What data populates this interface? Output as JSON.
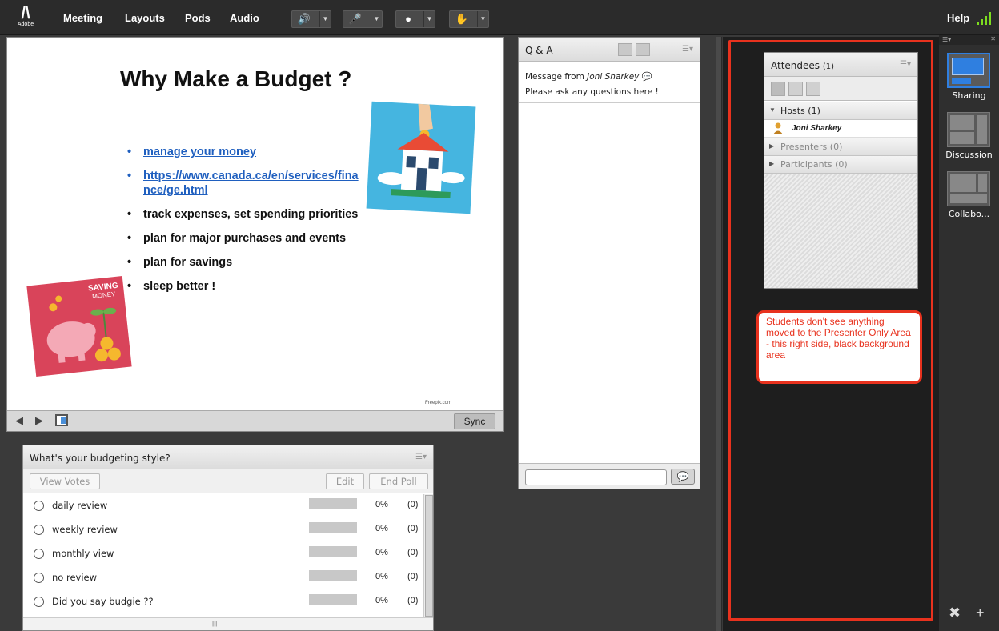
{
  "topbar": {
    "logo_text": "Adobe",
    "menus": [
      "Meeting",
      "Layouts",
      "Pods",
      "Audio"
    ],
    "help": "Help"
  },
  "share": {
    "title": "Why Make a Budget ?",
    "bullets": [
      {
        "text": "manage your money",
        "link": true
      },
      {
        "text": "https://www.canada.ca/en/services/finance/ge.html",
        "link": true
      },
      {
        "text": "track expenses, set spending priorities",
        "link": false
      },
      {
        "text": "plan for major purchases and events",
        "link": false
      },
      {
        "text": "plan for savings",
        "link": false
      },
      {
        "text": "sleep better !",
        "link": false
      }
    ],
    "bullet_line2": "ge.html",
    "piggy_text_1": "SAVING",
    "piggy_text_2": "MONEY",
    "credit": "Freepik.com",
    "sync_label": "Sync"
  },
  "qa": {
    "title": "Q & A",
    "message_prefix": "Message from",
    "message_author": "Joni Sharkey",
    "message_body": "Please ask any questions here !"
  },
  "poll": {
    "title": "What's your budgeting style?",
    "view_votes": "View Votes",
    "edit": "Edit",
    "end_poll": "End Poll",
    "options": [
      {
        "label": "daily review",
        "pct": "0%",
        "count": "(0)"
      },
      {
        "label": "weekly review",
        "pct": "0%",
        "count": "(0)"
      },
      {
        "label": "monthly view",
        "pct": "0%",
        "count": "(0)"
      },
      {
        "label": "no review",
        "pct": "0%",
        "count": "(0)"
      },
      {
        "label": "Did you say budgie ??",
        "pct": "0%",
        "count": "(0)"
      }
    ]
  },
  "attendees": {
    "title": "Attendees",
    "count": "(1)",
    "hosts": "Hosts (1)",
    "host_name": "Joni Sharkey",
    "presenters": "Presenters (0)",
    "participants": "Participants (0)"
  },
  "callout_text": "Students don't see anything moved to the Presenter Only Area - this right side, black background area",
  "layouts": [
    {
      "label": "Sharing",
      "active": true
    },
    {
      "label": "Discussion",
      "active": false
    },
    {
      "label": "Collabo...",
      "active": false
    }
  ],
  "colors": {
    "accent_red": "#e8321e",
    "audio_green": "#7ddc1f",
    "link_blue": "#1f5fbf"
  }
}
